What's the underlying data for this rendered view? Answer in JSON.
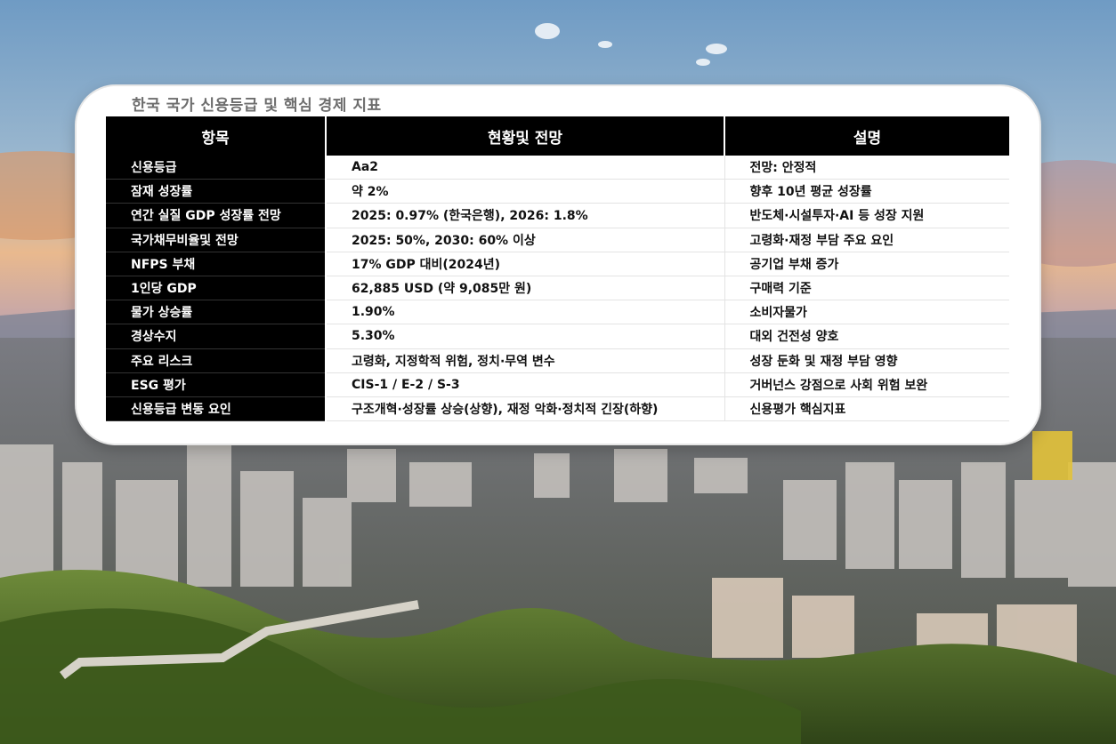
{
  "title": "한국 국가 신용등급 및 핵심 경제 지표",
  "headers": [
    "항목",
    "현황및 전망",
    "설명"
  ],
  "rows": [
    [
      "신용등급",
      "Aa2",
      "전망: 안정적"
    ],
    [
      "잠재 성장률",
      "약 2%",
      "향후 10년 평균 성장률"
    ],
    [
      "연간 실질 GDP 성장률 전망",
      "2025: 0.97% (한국은행), 2026: 1.8%",
      "반도체·시설투자·AI 등 성장 지원"
    ],
    [
      "국가채무비율및 전망",
      "2025: 50%, 2030: 60% 이상",
      "고령화·재정 부담 주요 요인"
    ],
    [
      "NFPS 부채",
      "17% GDP 대비(2024년)",
      "공기업 부채 증가"
    ],
    [
      "1인당 GDP",
      "62,885 USD (약 9,085만 원)",
      "구매력 기준"
    ],
    [
      "물가 상승률",
      "1.90%",
      "소비자물가"
    ],
    [
      "경상수지",
      "5.30%",
      "대외 건전성 양호"
    ],
    [
      "주요 리스크",
      "고령화, 지정학적 위험, 정치·무역 변수",
      "성장 둔화 및 재정 부담 영향"
    ],
    [
      "ESG 평가",
      "CIS-1 / E-2 / S-3",
      "거버넌스 강점으로 사회 위험 보완"
    ],
    [
      "신용등급 변동 요인",
      "구조개혁·성장률 상승(상향), 재정 악화·정치적 긴장(하향)",
      "신용평가 핵심지표"
    ]
  ]
}
